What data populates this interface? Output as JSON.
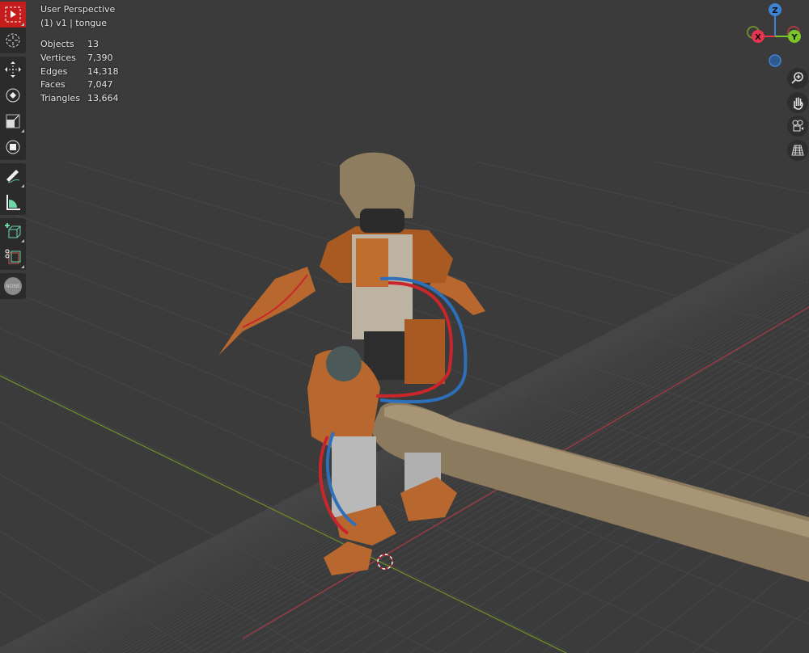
{
  "viewport": {
    "title": "User Perspective",
    "context": "(1) v1 | tongue",
    "stats": [
      {
        "label": "Objects",
        "value": "13"
      },
      {
        "label": "Vertices",
        "value": "7,390"
      },
      {
        "label": "Edges",
        "value": "14,318"
      },
      {
        "label": "Faces",
        "value": "7,047"
      },
      {
        "label": "Triangles",
        "value": "13,664"
      }
    ]
  },
  "toolbar": {
    "tools": [
      "select-box",
      "cursor",
      "move",
      "rotate",
      "scale",
      "transform",
      "annotate",
      "measure",
      "add-cube",
      "shear"
    ],
    "none_label": "NONE"
  },
  "gizmo": {
    "x": "X",
    "y": "Y",
    "z": "Z"
  },
  "colors": {
    "accent": "#c51c1c",
    "x_axis": "#e8354f",
    "y_axis": "#7ac62a",
    "z_axis": "#3d84d6",
    "background": "#3b3b3b"
  }
}
